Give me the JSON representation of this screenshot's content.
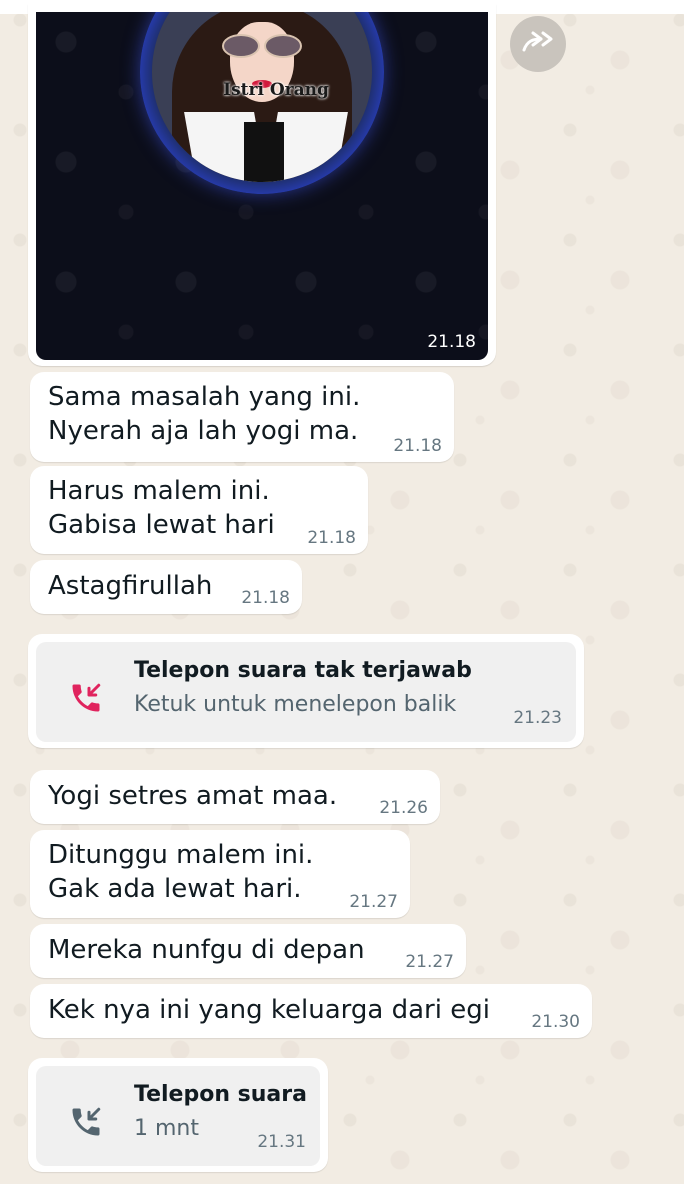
{
  "image_message": {
    "watermark": "Istri Orang",
    "time": "21.18"
  },
  "messages": [
    {
      "text": "Sama masalah yang ini.\nNyerah aja lah yogi ma.",
      "time": "21.18"
    },
    {
      "text": "Harus malem ini.\nGabisa lewat hari",
      "time": "21.18"
    },
    {
      "text": "Astagfirullah",
      "time": "21.18"
    },
    {
      "text": "Yogi setres amat maa.",
      "time": "21.26"
    },
    {
      "text": "Ditunggu malem ini.\nGak ada lewat hari.",
      "time": "21.27"
    },
    {
      "text": "Mereka nunfgu di depan",
      "time": "21.27"
    },
    {
      "text": "Kek nya ini yang keluarga dari egi",
      "time": "21.30"
    }
  ],
  "calls": [
    {
      "title": "Telepon suara tak terjawab",
      "subtitle": "Ketuk untuk menelepon balik",
      "time": "21.23",
      "icon": "missed-call-icon",
      "icon_color": "#e0245e"
    },
    {
      "title": "Telepon suara",
      "subtitle": "1 mnt",
      "time": "21.31",
      "icon": "incoming-call-icon",
      "icon_color": "#54656f"
    }
  ],
  "colors": {
    "chat_background": "#f2ece3",
    "bubble": "#ffffff",
    "timestamp": "#667781",
    "missed_call": "#e0245e"
  }
}
